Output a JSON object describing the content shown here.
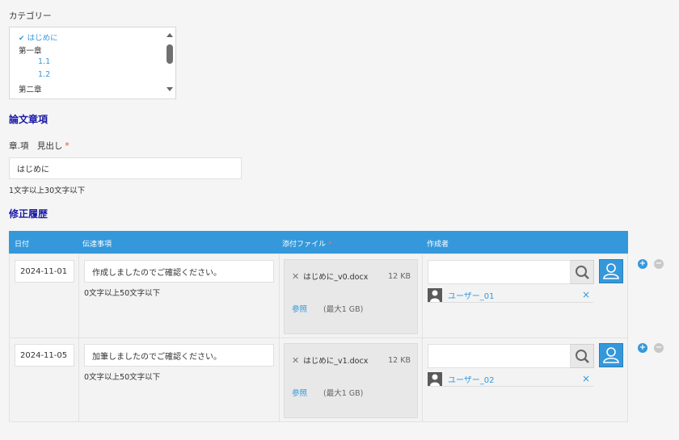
{
  "category": {
    "label": "カテゴリー",
    "items": [
      {
        "text": "はじめに",
        "selected": true
      },
      {
        "text": "第一章"
      },
      {
        "text": "1.1"
      },
      {
        "text": "1.2"
      },
      {
        "text": "第二章"
      }
    ]
  },
  "section1": {
    "title": "論文章項",
    "field_label": "章.項　見出し",
    "required_mark": "*",
    "value": "はじめに",
    "hint": "1文字以上30文字以下"
  },
  "section2": {
    "title": "修正履歴",
    "columns": [
      "日付",
      "伝達事項",
      "添付ファイル",
      "作成者"
    ],
    "required_mark": "*",
    "rows": [
      {
        "date": "2024-11-01",
        "message": "作成しましたのでご確認ください。",
        "hint": "0文字以上50文字以下",
        "file_name": "はじめに_v0.docx",
        "file_size": "12 KB",
        "browse": "参照",
        "max": "(最大1 GB)",
        "user": "ユーザー_01"
      },
      {
        "date": "2024-11-05",
        "message": "加筆しましたのでご確認ください。",
        "hint": "0文字以上50文字以下",
        "file_name": "はじめに_v1.docx",
        "file_size": "12 KB",
        "browse": "参照",
        "max": "(最大1 GB)",
        "user": "ユーザー_02"
      }
    ]
  },
  "colors": {
    "accent": "#3498db",
    "title": "#1a1aa6",
    "required": "#e74c3c"
  },
  "icons": [
    "check-icon",
    "search-icon",
    "user-icon",
    "close-icon",
    "plus-icon",
    "minus-icon",
    "file-remove-icon"
  ]
}
